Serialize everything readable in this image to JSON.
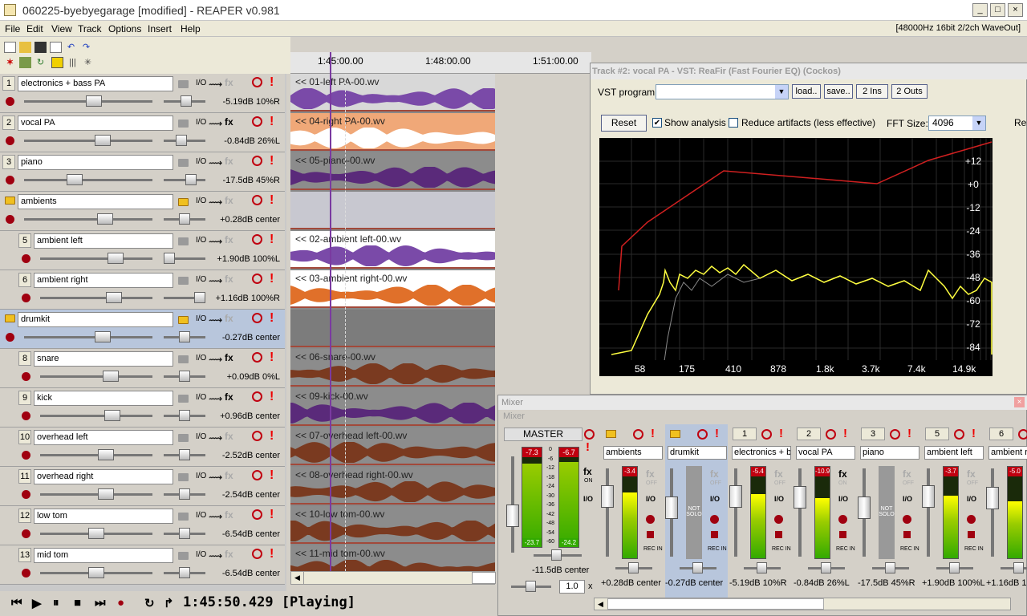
{
  "window": {
    "title": "060225-byebyegarage [modified] - REAPER v0.981",
    "min": "_",
    "max": "□",
    "close": "×"
  },
  "menu": {
    "items": [
      "File",
      "Edit",
      "View",
      "Track",
      "Options",
      "Insert",
      "Help"
    ],
    "status": "[48000Hz 16bit 2/2ch WaveOut]"
  },
  "tracks": [
    {
      "num": "1",
      "name": "electronics + bass PA",
      "readout": "-5.19dB 10%R",
      "folder": false,
      "indent": false,
      "fx": true,
      "vol": 0.55,
      "pan": 0.55
    },
    {
      "num": "2",
      "name": "vocal PA",
      "readout": "-0.84dB 26%L",
      "folder": false,
      "indent": false,
      "fx": true,
      "fxon": true,
      "vol": 0.63,
      "pan": 0.4
    },
    {
      "num": "3",
      "name": "piano",
      "readout": "-17.5dB 45%R",
      "folder": false,
      "indent": false,
      "fx": true,
      "vol": 0.38,
      "pan": 0.7
    },
    {
      "num": "",
      "name": "ambients",
      "readout": "+0.28dB center",
      "folder": true,
      "indent": false,
      "fx": true,
      "vol": 0.65,
      "pan": 0.5
    },
    {
      "num": "5",
      "name": "ambient left",
      "readout": "+1.90dB 100%L",
      "folder": false,
      "indent": true,
      "fx": true,
      "vol": 0.7,
      "pan": 0.0
    },
    {
      "num": "6",
      "name": "ambient right",
      "readout": "+1.16dB 100%R",
      "folder": false,
      "indent": true,
      "fx": true,
      "vol": 0.68,
      "pan": 1.0
    },
    {
      "num": "",
      "name": "drumkit",
      "readout": "-0.27dB center",
      "folder": true,
      "indent": false,
      "fx": true,
      "vol": 0.63,
      "pan": 0.5,
      "selected": true
    },
    {
      "num": "8",
      "name": "snare",
      "readout": "+0.09dB 0%L",
      "folder": false,
      "indent": true,
      "fx": true,
      "fxon": true,
      "vol": 0.65,
      "pan": 0.5
    },
    {
      "num": "9",
      "name": "kick",
      "readout": "+0.96dB center",
      "folder": false,
      "indent": true,
      "fx": true,
      "fxon": true,
      "vol": 0.67,
      "pan": 0.5
    },
    {
      "num": "10",
      "name": "overhead left",
      "readout": "-2.52dB center",
      "folder": false,
      "indent": true,
      "fx": true,
      "vol": 0.6,
      "pan": 0.5
    },
    {
      "num": "11",
      "name": "overhead right",
      "readout": "-2.54dB center",
      "folder": false,
      "indent": true,
      "fx": true,
      "vol": 0.6,
      "pan": 0.5
    },
    {
      "num": "12",
      "name": "low tom",
      "readout": "-6.54dB center",
      "folder": false,
      "indent": true,
      "fx": true,
      "vol": 0.5,
      "pan": 0.5
    },
    {
      "num": "13",
      "name": "mid tom",
      "readout": "-6.54dB center",
      "folder": false,
      "indent": true,
      "fx": true,
      "vol": 0.5,
      "pan": 0.5
    }
  ],
  "track_icons": {
    "io": "I/O",
    "env": "⟿",
    "fx": "fx",
    "solo": "!"
  },
  "ruler": [
    "1:45:00.00",
    "1:48:00.00",
    "1:51:00.00"
  ],
  "items": [
    {
      "label": "<< 01-left PA-00.wv",
      "color": "#d8d8d8",
      "wave": "#7a4aa8"
    },
    {
      "label": "<< 04-right PA-00.wv",
      "color": "#f0a878",
      "wave": "#ffffff"
    },
    {
      "label": "<< 05-piano-00.wv",
      "color": "#8c8c8c",
      "wave": "#5a2a7a"
    },
    {
      "label": "",
      "color": "#c8c8d0",
      "wave": ""
    },
    {
      "label": "<< 02-ambient left-00.wv",
      "color": "#ffffff",
      "wave": "#7a4aa8"
    },
    {
      "label": "<< 03-ambient right-00.wv",
      "color": "#ffffff",
      "wave": "#e0702a"
    },
    {
      "label": "",
      "color": "#7c7c7c",
      "wave": ""
    },
    {
      "label": "<< 06-snare-00.wv",
      "color": "#8c8c8c",
      "wave": "#7a3a20"
    },
    {
      "label": "<< 09-kick-00.wv",
      "color": "#8c8c8c",
      "wave": "#5a2a7a"
    },
    {
      "label": "<< 07-overhead left-00.wv",
      "color": "#8c8c8c",
      "wave": "#7a3a20"
    },
    {
      "label": "<< 08-overhead right-00.wv",
      "color": "#8c8c8c",
      "wave": "#7a3a20"
    },
    {
      "label": "<< 10-low tom-00.wv",
      "color": "#8c8c8c",
      "wave": "#7a3a20"
    },
    {
      "label": "<< 11-mid tom-00.wv",
      "color": "#8c8c8c",
      "wave": "#7a3a20"
    }
  ],
  "transport": {
    "time": "1:45:50.429 [Playing]"
  },
  "vst": {
    "title": "Track #2: vocal PA - VST: ReaFir (Fast Fourier EQ) (Cockos)",
    "program_label": "VST program:",
    "load": "load..",
    "save": "save..",
    "ins": "2 Ins",
    "outs": "2 Outs",
    "reset": "Reset",
    "show_analysis": "Show analysis",
    "reduce": "Reduce artifacts (less effective)",
    "fft_label": "FFT Size:",
    "fft_value": "4096",
    "cut": "Re",
    "y_labels": [
      "+12",
      "+0",
      "-12",
      "-24",
      "-36",
      "-48",
      "-60",
      "-72",
      "-84"
    ],
    "x_labels": [
      "58",
      "175",
      "410",
      "878",
      "1.8k",
      "3.7k",
      "7.4k",
      "14.9k"
    ]
  },
  "mixer": {
    "title": "Mixer",
    "subtitle": "Mixer",
    "master": {
      "name": "MASTER",
      "peakL": "-7.3",
      "peakR": "-6.7",
      "rmsL": "-23.7",
      "rmsR": "-24.2",
      "readout": "-11.5dB center",
      "rate": "1.0",
      "rate_x": "x",
      "scale": [
        "0",
        "-6",
        "-12",
        "-18",
        "-24",
        "-30",
        "-36",
        "-42",
        "-48",
        "-54",
        "-60"
      ]
    },
    "strips": [
      {
        "num": "",
        "name": "ambients",
        "peak": "-3.4",
        "level": 0.72,
        "readout": "+0.28dB center",
        "folder": true,
        "fx": "fx",
        "fxon": false,
        "notsolo": false
      },
      {
        "num": "",
        "name": "drumkit",
        "peak": "",
        "level": 0,
        "readout": "-0.27dB center",
        "folder": true,
        "fx": "fx",
        "fxon": false,
        "notsolo": true,
        "selected": true
      },
      {
        "num": "1",
        "name": "electronics + b",
        "peak": "-5.4",
        "level": 0.7,
        "readout": "-5.19dB 10%R",
        "folder": false,
        "fx": "fx",
        "fxon": false,
        "notsolo": false
      },
      {
        "num": "2",
        "name": "vocal PA",
        "peak": "-10.9",
        "level": 0.66,
        "readout": "-0.84dB 26%L",
        "folder": false,
        "fx": "fx",
        "fxon": true,
        "notsolo": false
      },
      {
        "num": "3",
        "name": "piano",
        "peak": "",
        "level": 0,
        "readout": "-17.5dB 45%R",
        "folder": false,
        "fx": "fx",
        "fxon": false,
        "notsolo": true
      },
      {
        "num": "5",
        "name": "ambient left",
        "peak": "-3.7",
        "level": 0.68,
        "readout": "+1.90dB 100%L",
        "folder": false,
        "fx": "fx",
        "fxon": false,
        "notsolo": false
      },
      {
        "num": "6",
        "name": "ambient ri",
        "peak": "-5.0",
        "level": 0.62,
        "readout": "+1.16dB 1",
        "folder": false,
        "fx": "fx",
        "fxon": false,
        "notsolo": false
      }
    ],
    "labels": {
      "on": "ON",
      "off": "OFF",
      "io": "I/O",
      "recin": "REC IN",
      "notsolo": "NOT SOLO"
    }
  }
}
